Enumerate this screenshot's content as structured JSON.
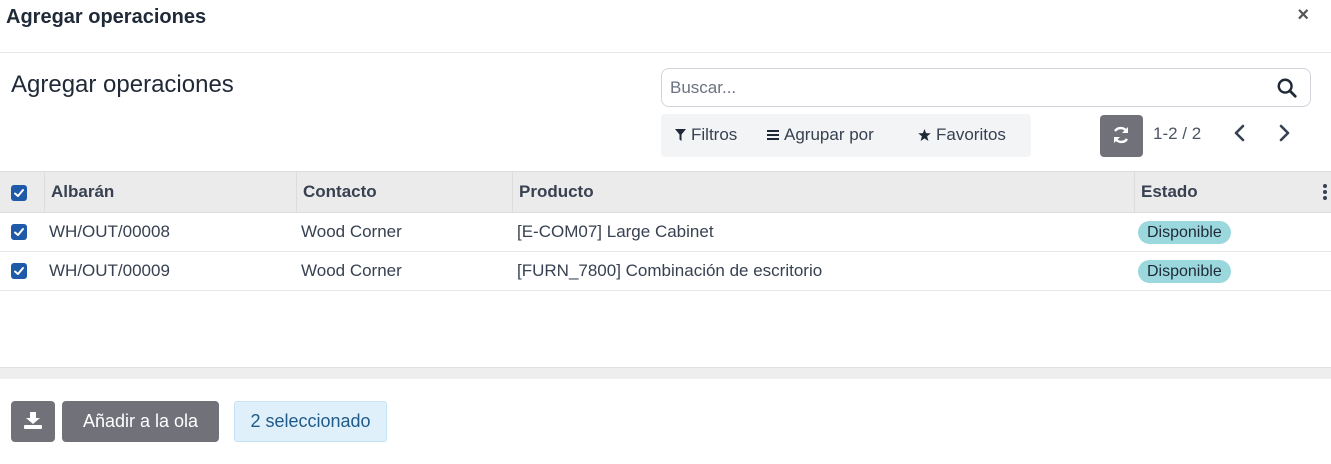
{
  "modal": {
    "title": "Agregar operaciones",
    "close_icon": "close-icon"
  },
  "page": {
    "title": "Agregar operaciones"
  },
  "search": {
    "placeholder": "Buscar...",
    "icon": "search-icon"
  },
  "filters": {
    "filters_label": "Filtros",
    "filters_icon": "funnel-icon",
    "group_label": "Agrupar por",
    "group_icon": "list-icon",
    "favorites_label": "Favoritos",
    "favorites_icon": "star-icon"
  },
  "pager": {
    "refresh_icon": "refresh-icon",
    "value": "1-2 / 2",
    "prev_icon": "chevron-left-icon",
    "next_icon": "chevron-right-icon"
  },
  "table": {
    "columns": [
      "Albarán",
      "Contacto",
      "Producto",
      "Estado"
    ],
    "header_checked": true,
    "options_icon": "kebab-menu-icon",
    "rows": [
      {
        "albaran": "WH/OUT/00008",
        "contacto": "Wood Corner",
        "producto": "[E-COM07] Large Cabinet",
        "estado": "Disponible",
        "checked": true
      },
      {
        "albaran": "WH/OUT/00009",
        "contacto": "Wood Corner",
        "producto": "[FURN_7800] Combinación de escritorio",
        "estado": "Disponible",
        "checked": true
      }
    ]
  },
  "footer": {
    "download_icon": "download-icon",
    "add_label": "Añadir a la ola",
    "selected_label": "2 seleccionado"
  },
  "colors": {
    "primary_checkbox": "#1e5aa8",
    "button_gray": "#71717a",
    "status_badge": "#9bd8de",
    "selected_badge_bg": "#e0f0fb"
  }
}
